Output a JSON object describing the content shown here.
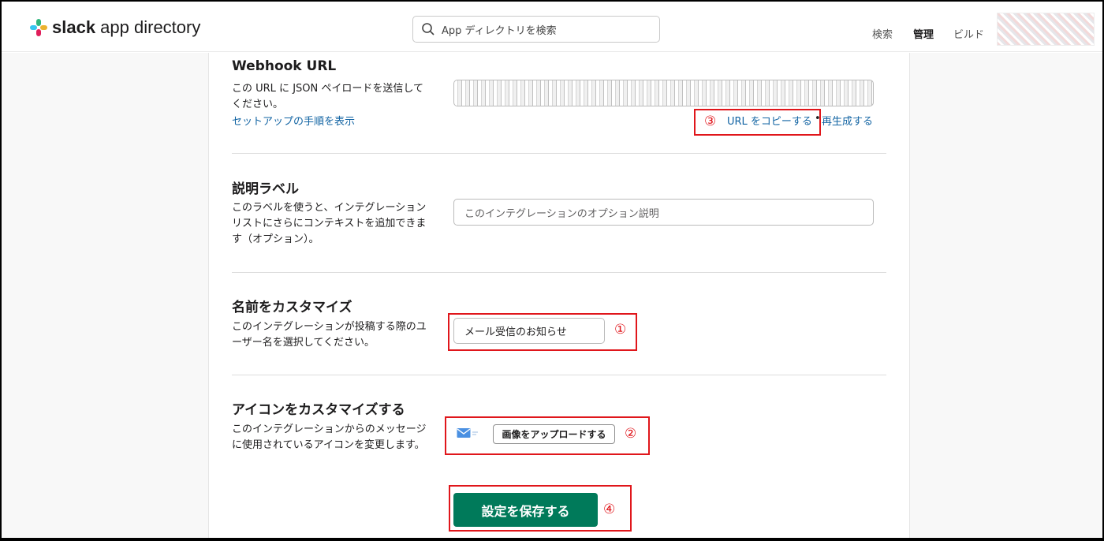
{
  "header": {
    "brand_bold": "slack",
    "brand_rest": " app directory",
    "search_placeholder": "App ディレクトリを検索",
    "nav": [
      "検索",
      "管理",
      "ビルド"
    ]
  },
  "webhook": {
    "title": "Webhook URL",
    "desc": "この URL に JSON ペイロードを送信してください。",
    "setup_link": "セットアップの手順を表示",
    "copy_link": "URL をコピーする",
    "separator": "•",
    "regen_link": "再生成する"
  },
  "label_section": {
    "title": "説明ラベル",
    "desc": "このラベルを使うと、インテグレーションリストにさらにコンテキストを追加できます（オプション）。",
    "placeholder": "このインテグレーションのオプション説明"
  },
  "name_section": {
    "title": "名前をカスタマイズ",
    "desc": "このインテグレーションが投稿する際のユーザー名を選択してください。",
    "value": "メール受信のお知らせ"
  },
  "icon_section": {
    "title": "アイコンをカスタマイズする",
    "desc": "このインテグレーションからのメッセージに使用されているアイコンを変更します。",
    "upload_label": "画像をアップロードする",
    "icon": "mail-icon"
  },
  "save_label": "設定を保存する",
  "annotations": {
    "one": "①",
    "two": "②",
    "three": "③",
    "four": "④"
  },
  "colors": {
    "link": "#1264a3",
    "save_button": "#007a5a",
    "annotation": "#e0161b"
  }
}
